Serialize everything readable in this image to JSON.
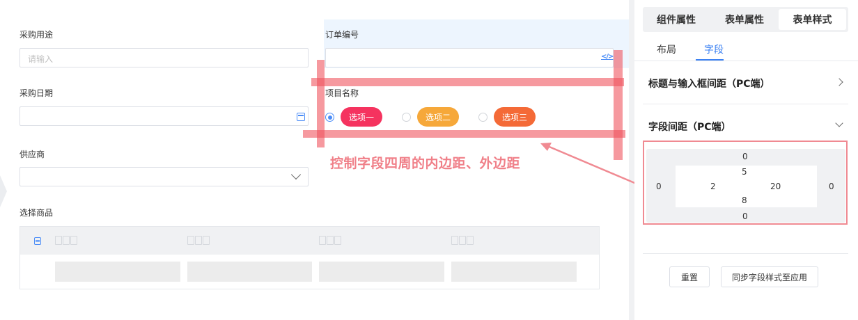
{
  "form": {
    "purchase_purpose_label": "采购用途",
    "purchase_purpose_placeholder": "请输入",
    "order_number_label": "订单编号",
    "purchase_date_label": "采购日期",
    "project_name_label": "项目名称",
    "supplier_label": "供应商",
    "select_goods_label": "选择商品",
    "options": [
      {
        "label": "选项一",
        "color": "#f5335f",
        "selected": true
      },
      {
        "label": "选项二",
        "color": "#f6a83a",
        "selected": false
      },
      {
        "label": "选项三",
        "color": "#f46a37",
        "selected": false
      }
    ]
  },
  "annotation": {
    "callout": "控制字段四周的内边距、外边距"
  },
  "panel": {
    "tabs": [
      "组件属性",
      "表单属性",
      "表单样式"
    ],
    "active_tab": "表单样式",
    "subtabs": [
      "布局",
      "字段"
    ],
    "active_subtab": "字段",
    "section1_title": "标题与输入框间距（PC端）",
    "section2_title": "字段间距（PC端）",
    "spacing": {
      "outer_top": "0",
      "outer_left": "0",
      "outer_right": "0",
      "outer_bottom": "0",
      "inner_top": "5",
      "inner_left": "2",
      "inner_right": "20",
      "inner_bottom": "8"
    },
    "reset_label": "重置",
    "sync_label": "同步字段样式至应用"
  },
  "colors": {
    "accent": "#3d82f2",
    "annotation_red": "#f0505a"
  }
}
